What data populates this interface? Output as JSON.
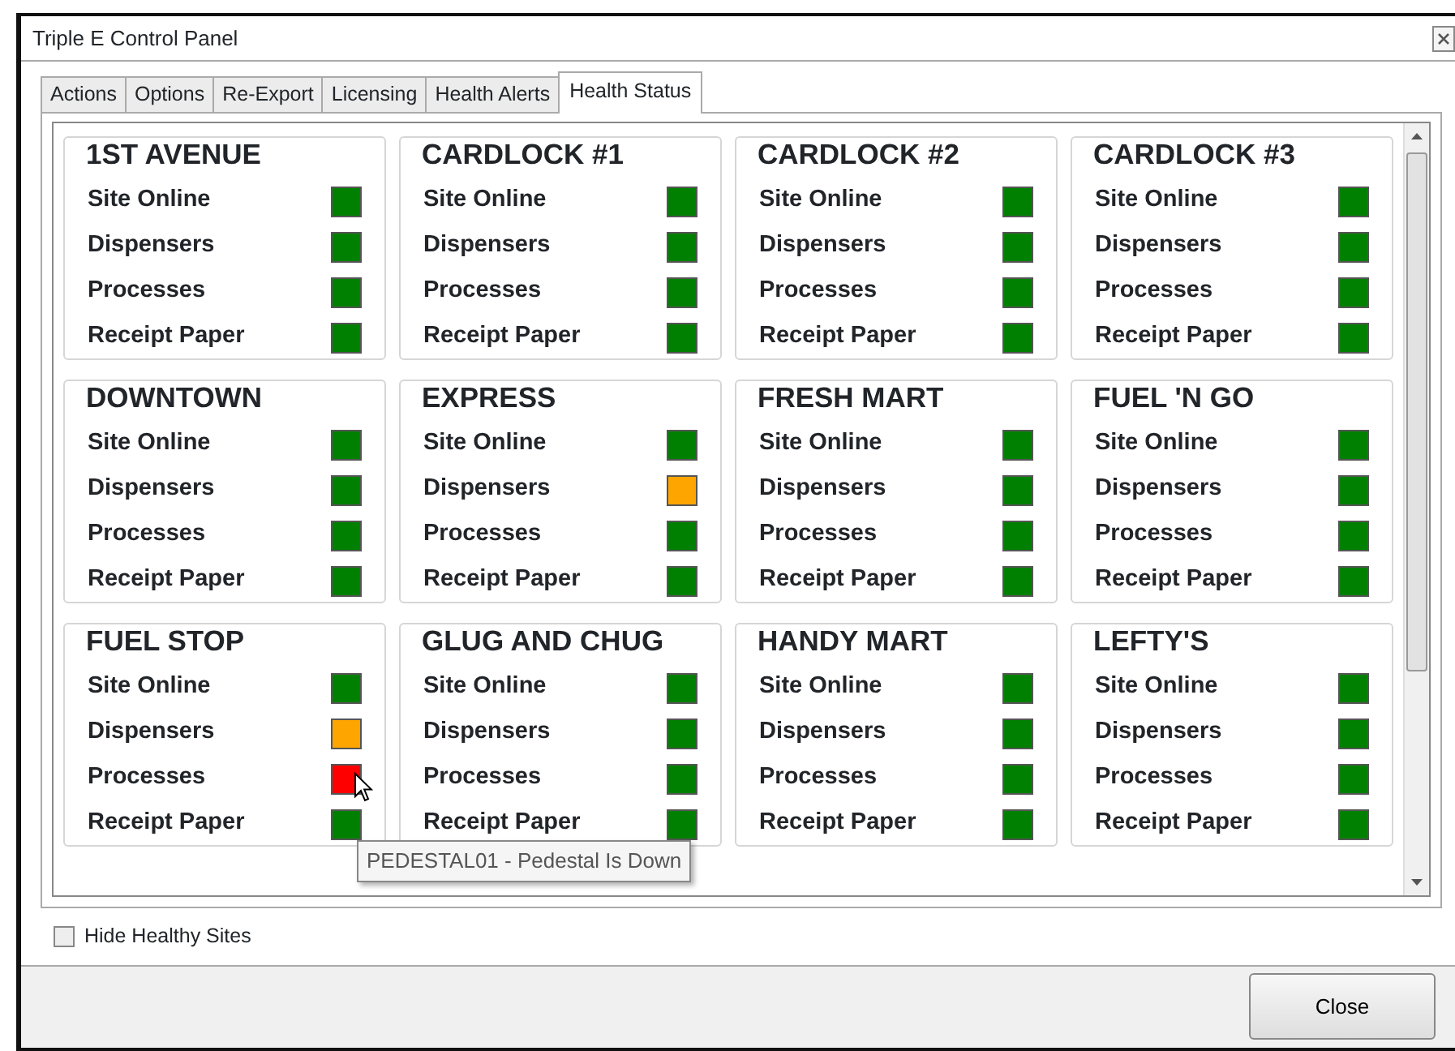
{
  "window": {
    "title": "Triple E Control Panel"
  },
  "tabs": [
    {
      "label": "Actions",
      "selected": false
    },
    {
      "label": "Options",
      "selected": false
    },
    {
      "label": "Re-Export",
      "selected": false
    },
    {
      "label": "Licensing",
      "selected": false
    },
    {
      "label": "Health Alerts",
      "selected": false
    },
    {
      "label": "Health Status",
      "selected": true
    }
  ],
  "sites": [
    {
      "name": "1ST AVENUE",
      "checks": [
        {
          "label": "Site Online",
          "color": "#008000"
        },
        {
          "label": "Dispensers",
          "color": "#008000"
        },
        {
          "label": "Processes",
          "color": "#008000"
        },
        {
          "label": "Receipt Paper",
          "color": "#008000"
        }
      ]
    },
    {
      "name": "CARDLOCK #1",
      "checks": [
        {
          "label": "Site Online",
          "color": "#008000"
        },
        {
          "label": "Dispensers",
          "color": "#008000"
        },
        {
          "label": "Processes",
          "color": "#008000"
        },
        {
          "label": "Receipt Paper",
          "color": "#008000"
        }
      ]
    },
    {
      "name": "CARDLOCK #2",
      "checks": [
        {
          "label": "Site Online",
          "color": "#008000"
        },
        {
          "label": "Dispensers",
          "color": "#008000"
        },
        {
          "label": "Processes",
          "color": "#008000"
        },
        {
          "label": "Receipt Paper",
          "color": "#008000"
        }
      ]
    },
    {
      "name": "CARDLOCK #3",
      "checks": [
        {
          "label": "Site Online",
          "color": "#008000"
        },
        {
          "label": "Dispensers",
          "color": "#008000"
        },
        {
          "label": "Processes",
          "color": "#008000"
        },
        {
          "label": "Receipt Paper",
          "color": "#008000"
        }
      ]
    },
    {
      "name": "DOWNTOWN",
      "checks": [
        {
          "label": "Site Online",
          "color": "#008000"
        },
        {
          "label": "Dispensers",
          "color": "#008000"
        },
        {
          "label": "Processes",
          "color": "#008000"
        },
        {
          "label": "Receipt Paper",
          "color": "#008000"
        }
      ]
    },
    {
      "name": "EXPRESS",
      "checks": [
        {
          "label": "Site Online",
          "color": "#008000"
        },
        {
          "label": "Dispensers",
          "color": "#ffa500"
        },
        {
          "label": "Processes",
          "color": "#008000"
        },
        {
          "label": "Receipt Paper",
          "color": "#008000"
        }
      ]
    },
    {
      "name": "FRESH MART",
      "checks": [
        {
          "label": "Site Online",
          "color": "#008000"
        },
        {
          "label": "Dispensers",
          "color": "#008000"
        },
        {
          "label": "Processes",
          "color": "#008000"
        },
        {
          "label": "Receipt Paper",
          "color": "#008000"
        }
      ]
    },
    {
      "name": "FUEL 'N GO",
      "checks": [
        {
          "label": "Site Online",
          "color": "#008000"
        },
        {
          "label": "Dispensers",
          "color": "#008000"
        },
        {
          "label": "Processes",
          "color": "#008000"
        },
        {
          "label": "Receipt Paper",
          "color": "#008000"
        }
      ]
    },
    {
      "name": "FUEL STOP",
      "checks": [
        {
          "label": "Site Online",
          "color": "#008000"
        },
        {
          "label": "Dispensers",
          "color": "#ffa500"
        },
        {
          "label": "Processes",
          "color": "#ff0000",
          "tooltip": "PEDESTAL01 - Pedestal Is Down"
        },
        {
          "label": "Receipt Paper",
          "color": "#008000"
        }
      ]
    },
    {
      "name": "GLUG AND CHUG",
      "checks": [
        {
          "label": "Site Online",
          "color": "#008000"
        },
        {
          "label": "Dispensers",
          "color": "#008000"
        },
        {
          "label": "Processes",
          "color": "#008000"
        },
        {
          "label": "Receipt Paper",
          "color": "#008000"
        }
      ]
    },
    {
      "name": "HANDY MART",
      "checks": [
        {
          "label": "Site Online",
          "color": "#008000"
        },
        {
          "label": "Dispensers",
          "color": "#008000"
        },
        {
          "label": "Processes",
          "color": "#008000"
        },
        {
          "label": "Receipt Paper",
          "color": "#008000"
        }
      ]
    },
    {
      "name": "LEFTY'S",
      "checks": [
        {
          "label": "Site Online",
          "color": "#008000"
        },
        {
          "label": "Dispensers",
          "color": "#008000"
        },
        {
          "label": "Processes",
          "color": "#008000"
        },
        {
          "label": "Receipt Paper",
          "color": "#008000"
        }
      ]
    }
  ],
  "hide_healthy": {
    "label": "Hide Healthy Sites",
    "checked": false
  },
  "buttons": [
    "Close"
  ]
}
